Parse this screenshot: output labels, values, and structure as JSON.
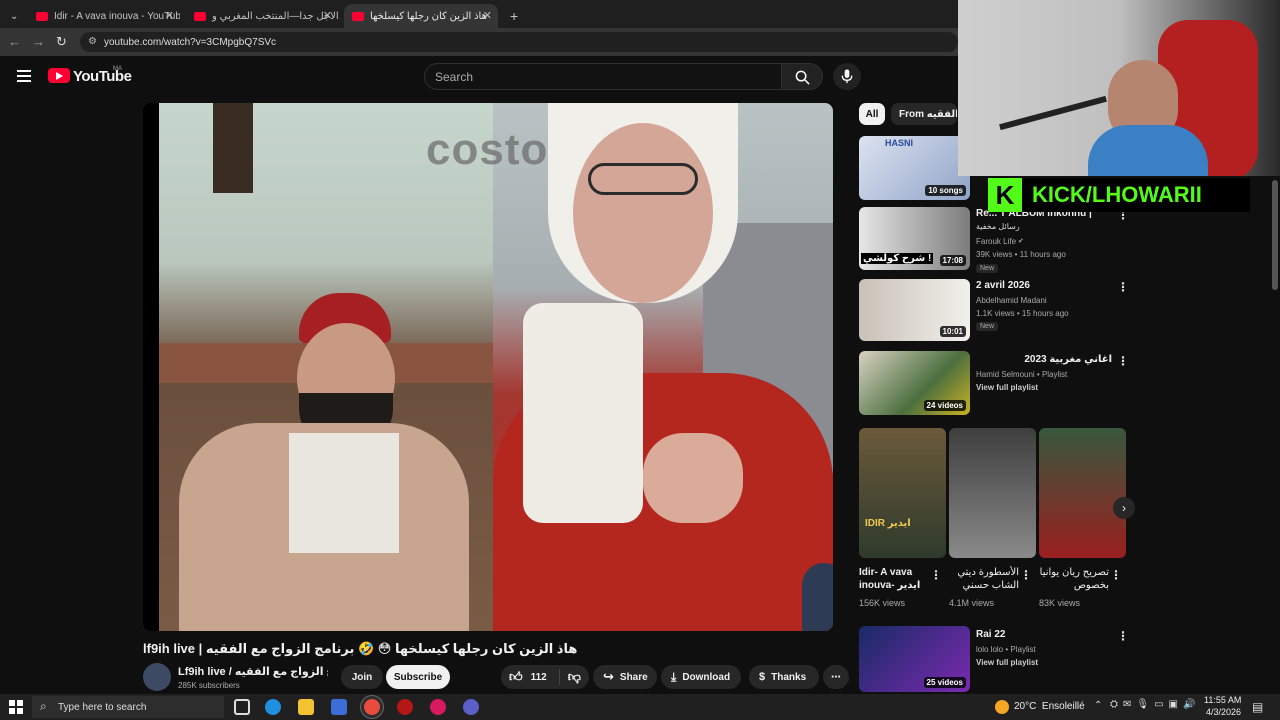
{
  "browser": {
    "tabs": [
      {
        "title": "Idir - A vava inouva - YouTube",
        "active": false
      },
      {
        "title": "عاالاجل جدا—المنتخب المغربي و",
        "active": false
      },
      {
        "title": "هاذ الزين كان رجلها كيسلخها",
        "active": true
      }
    ],
    "url": "youtube.com/watch?v=3CMpgbQ7SVc"
  },
  "youtube": {
    "logo_text": "YouTube",
    "region": "MA",
    "search_placeholder": "Search"
  },
  "video": {
    "watermark": "costo",
    "title": "lf9ih live | هاذ الزين كان رجلها كيسلخها 😳 🤣 برنامج الزواج مع الفقيه",
    "channel": "Lf9ih live / برنامج الزواج مع الفقيه",
    "subscribers": "285K subscribers",
    "join_label": "Join",
    "subscribe_label": "Subscribe",
    "likes": "112",
    "share_label": "Share",
    "download_label": "Download",
    "thanks_label": "Thanks"
  },
  "overlay": {
    "kick_text": "KICK/LHOWARII"
  },
  "sidebar": {
    "chips": [
      "All",
      "From برنامج الزواج مع الفقيه"
    ],
    "items": [
      {
        "badge": "10 songs",
        "thumb_text": "HASNI"
      },
      {
        "title": "Re... T ALBUM Inkonnu |",
        "subtitle": "رسائل مخفية",
        "channel": "Farouk Life",
        "meta": "39K views • 11 hours ago",
        "tag": "New",
        "badge": "17:08",
        "thumb_text": "شرح كولشي !"
      },
      {
        "title": "2 avril 2026",
        "channel": "Abdelhamid Madani",
        "meta": "1.1K views • 15 hours ago",
        "tag": "New",
        "badge": "10:01"
      },
      {
        "title": "اغاني مغربية 2023",
        "channel": "Hamid Selmouni • Playlist",
        "meta": "View full playlist",
        "badge": "24 videos"
      },
      {
        "title": "Rai 22",
        "channel": "lolo lolo • Playlist",
        "meta": "View full playlist",
        "badge": "25 videos"
      }
    ],
    "shorts": [
      {
        "title": "Idir- A vava inouva- ايدير",
        "views": "156K views",
        "thumb_text": "IDIR ايدير"
      },
      {
        "title": "الأسطورة ديتي الشاب حسني",
        "views": "4.1M views"
      },
      {
        "title": "تصريح ريان يوانيا بخصوص",
        "views": "83K views"
      }
    ]
  },
  "taskbar": {
    "search_placeholder": "Type here to search",
    "weather": "20°C  Ensoleillé",
    "time": "11:55 AM",
    "date": "4/3/2026"
  }
}
